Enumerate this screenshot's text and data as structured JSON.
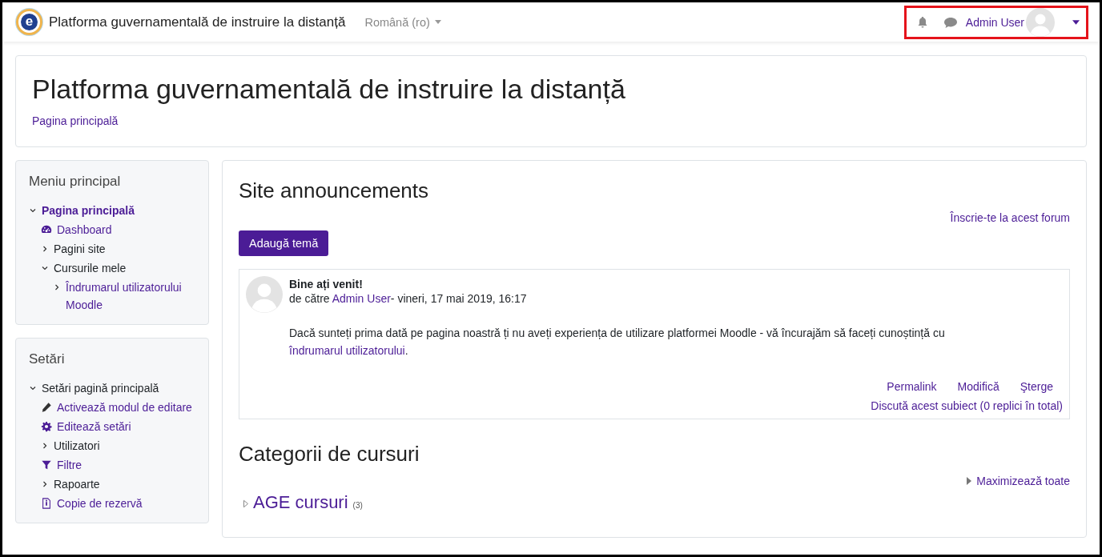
{
  "navbar": {
    "logo_letter": "e",
    "site_name": "Platforma guvernamentală de instruire la distanță",
    "language": "Română (ro)",
    "user_name": "Admin User",
    "highlighted": true
  },
  "page_header": {
    "title": "Platforma guvernamentală de instruire la distanță",
    "breadcrumb": "Pagina principală"
  },
  "blocks": [
    {
      "title": "Meniu principal",
      "items": [
        {
          "label": "Pagina principală",
          "kind": "course",
          "expanded": true,
          "selected": true,
          "children": [
            {
              "label": "Dashboard",
              "kind": "dashboard",
              "selected": false
            },
            {
              "label": "Pagini site",
              "kind": "section",
              "expanded": false,
              "selected": false
            },
            {
              "label": "Cursurile mele",
              "kind": "section",
              "expanded": true,
              "selected": false,
              "children": [
                {
                  "label": "Îndrumarul utilizatorului Moodle",
                  "kind": "course",
                  "expanded": false,
                  "selected": false
                }
              ]
            }
          ]
        }
      ]
    },
    {
      "title": "Setări",
      "items": [
        {
          "label": "Setări pagină principală",
          "kind": "section",
          "expanded": true,
          "selected": false,
          "children": [
            {
              "label": "Activează modul de editare",
              "kind": "pencil",
              "selected": false
            },
            {
              "label": "Editează setări",
              "kind": "gear",
              "selected": false
            },
            {
              "label": "Utilizatori",
              "kind": "section",
              "expanded": false,
              "selected": false
            },
            {
              "label": "Filtre",
              "kind": "filter",
              "selected": false
            },
            {
              "label": "Rapoarte",
              "kind": "section",
              "expanded": false,
              "selected": false
            },
            {
              "label": "Copie de rezervă",
              "kind": "file",
              "selected": false
            }
          ]
        }
      ]
    }
  ],
  "forum": {
    "title": "Site announcements",
    "subscribe_link": "Înscrie-te la acest forum",
    "add_button": "Adaugă temă",
    "post": {
      "subject": "Bine ați venit!",
      "by": "de către",
      "author": "Admin User",
      "date": "- vineri, 17 mai 2019, 16:17",
      "message": "Dacă sunteți prima dată pe pagina noastră ți nu aveți experiența de utilizare platformei Moodle - vă încurajăm să faceți cunoștință cu",
      "message_link": "îndrumarul utilizatorului",
      "message_end": ".",
      "actions": [
        "Permalink",
        "Modifică",
        "Şterge"
      ],
      "discuss": "Discută acest subiect (0 replici în total)"
    }
  },
  "categories": {
    "title": "Categorii de cursuri",
    "expand_all": "Maximizează toate",
    "items": [
      {
        "name": "AGE cursuri",
        "count": "(3)"
      }
    ]
  }
}
